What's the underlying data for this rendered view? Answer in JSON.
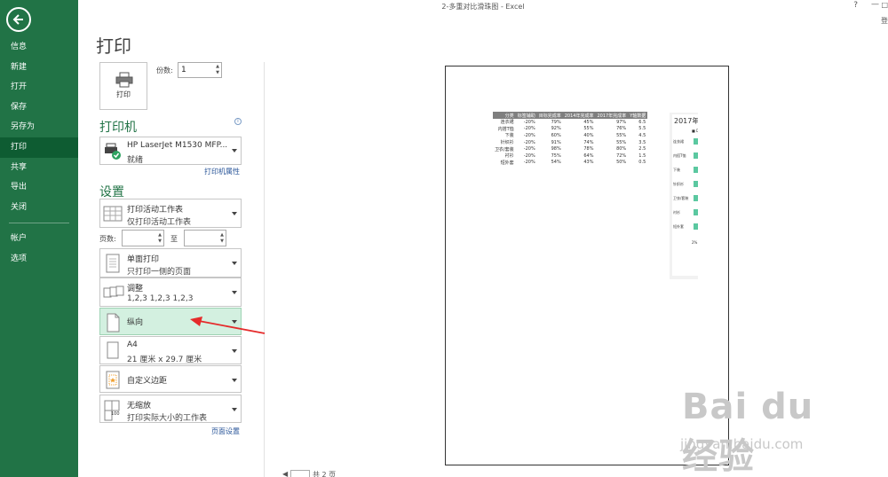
{
  "window": {
    "title": "2-多重对比滑珠图 - Excel",
    "help": "?",
    "min": "—",
    "extra": "□",
    "login": "登"
  },
  "nav": {
    "items": [
      "信息",
      "新建",
      "打开",
      "保存",
      "另存为",
      "打印",
      "共享",
      "导出",
      "关闭"
    ],
    "items2": [
      "帐户",
      "选项"
    ],
    "active_index": 5
  },
  "print": {
    "heading": "打印",
    "button_label": "打印",
    "copies_label": "份数:",
    "copies_value": "1"
  },
  "printer": {
    "section_title": "打印机",
    "name": "HP LaserJet M1530 MFP...",
    "status": "就绪",
    "properties_link": "打印机属性",
    "info": "i"
  },
  "settings": {
    "section_title": "设置",
    "scope": {
      "line1": "打印活动工作表",
      "line2": "仅打印活动工作表"
    },
    "pages_label": "页数:",
    "pages_to_label": "至",
    "sides": {
      "line1": "单面打印",
      "line2": "只打印一侧的页面"
    },
    "collate": {
      "line1": "调整",
      "line2": "1,2,3    1,2,3    1,2,3"
    },
    "orientation": "纵向",
    "paper": {
      "line1": "A4",
      "line2": "21 厘米 x 29.7 厘米"
    },
    "margins": "自定义边距",
    "scaling": {
      "line1": "无缩放",
      "line2": "打印实际大小的工作表"
    },
    "page_setup_link": "页面设置",
    "scaling_icon_num": "100"
  },
  "preview": {
    "headers": [
      "分类",
      "标签辅助",
      "目标完成率",
      "2014年完成率",
      "2017年完成率",
      "Y轴数据"
    ],
    "rows": [
      [
        "连衣裙",
        "-20%",
        "79%",
        "45%",
        "97%",
        "6.5"
      ],
      [
        "内搭T恤",
        "-20%",
        "92%",
        "55%",
        "76%",
        "5.5"
      ],
      [
        "下装",
        "-20%",
        "60%",
        "40%",
        "55%",
        "4.5"
      ],
      [
        "针织衫",
        "-20%",
        "91%",
        "74%",
        "55%",
        "3.5"
      ],
      [
        "卫衣/套装",
        "-20%",
        "98%",
        "78%",
        "80%",
        "2.5"
      ],
      [
        "衬衫",
        "-20%",
        "75%",
        "64%",
        "72%",
        "1.5"
      ],
      [
        "短外套",
        "-20%",
        "54%",
        "43%",
        "50%",
        "0.5"
      ]
    ],
    "mini_chart": {
      "title": "2017年",
      "legend": "■ D",
      "labels": [
        "连衣裙",
        "内搭T恤",
        "下装",
        "针织衫",
        "卫衣/套装",
        "衬衫",
        "短外套"
      ],
      "foot": "2%",
      "bar_color": "#5bc8a0"
    }
  },
  "pagenav": {
    "prev": "◀",
    "page": "1",
    "of": "共 2 页"
  },
  "watermark": {
    "brand": "Bai du 经验",
    "sub": "jingyan.baidu.com"
  },
  "colors": {
    "accent": "#217346",
    "selected": "#d3f0e0",
    "link": "#2a5699",
    "arrow": "#e52b2b"
  }
}
